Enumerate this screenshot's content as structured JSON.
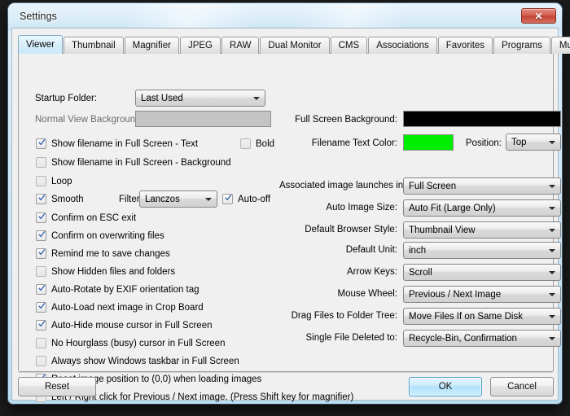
{
  "window": {
    "title": "Settings",
    "close_icon": "close-icon",
    "close_glyph": "✕"
  },
  "tabs": [
    {
      "label": "Viewer",
      "active": true
    },
    {
      "label": "Thumbnail",
      "active": false
    },
    {
      "label": "Magnifier",
      "active": false
    },
    {
      "label": "JPEG",
      "active": false
    },
    {
      "label": "RAW",
      "active": false
    },
    {
      "label": "Dual Monitor",
      "active": false
    },
    {
      "label": "CMS",
      "active": false
    },
    {
      "label": "Associations",
      "active": false
    },
    {
      "label": "Favorites",
      "active": false
    },
    {
      "label": "Programs",
      "active": false
    },
    {
      "label": "Music",
      "active": false
    }
  ],
  "left": {
    "startup_folder_label": "Startup Folder:",
    "startup_folder_value": "Last Used",
    "normal_view_background_label": "Normal View Background:",
    "normal_view_background_color": "#c4c4c4",
    "filter_label": "Filter:",
    "filter_value": "Lanczos",
    "auto_off_label": "Auto-off",
    "bold_label": "Bold",
    "checkboxes": [
      {
        "label": "Show filename in Full Screen - Text",
        "checked": true
      },
      {
        "label": "Show filename in Full Screen - Background",
        "checked": false
      },
      {
        "label": "Loop",
        "checked": false
      },
      {
        "label": "Smooth",
        "checked": true
      },
      {
        "label": "Confirm on ESC exit",
        "checked": true
      },
      {
        "label": "Confirm on overwriting files",
        "checked": true
      },
      {
        "label": "Remind me to save changes",
        "checked": true
      },
      {
        "label": "Show Hidden files and folders",
        "checked": false
      },
      {
        "label": "Auto-Rotate by EXIF orientation tag",
        "checked": true
      },
      {
        "label": "Auto-Load next image in Crop Board",
        "checked": true
      },
      {
        "label": "Auto-Hide mouse cursor in Full Screen",
        "checked": true
      },
      {
        "label": "No Hourglass (busy) cursor in Full Screen",
        "checked": false
      },
      {
        "label": "Always show Windows taskbar in Full Screen",
        "checked": false
      },
      {
        "label": "Reset image position to (0,0) when loading images",
        "checked": true
      },
      {
        "label": "Left / Right click for Previous / Next image. (Press Shift key for magnifier)",
        "checked": false
      }
    ]
  },
  "right": {
    "full_screen_background_label": "Full Screen Background:",
    "full_screen_background_color": "#000000",
    "filename_text_color_label": "Filename Text Color:",
    "filename_text_color": "#00ee00",
    "position_label": "Position:",
    "position_value": "Top",
    "dropdowns": [
      {
        "label": "Associated image launches in:",
        "value": "Full Screen"
      },
      {
        "label": "Auto Image Size:",
        "value": "Auto Fit (Large Only)"
      },
      {
        "label": "Default Browser Style:",
        "value": "Thumbnail View"
      },
      {
        "label": "Default Unit:",
        "value": "inch"
      },
      {
        "label": "Arrow Keys:",
        "value": "Scroll"
      },
      {
        "label": "Mouse Wheel:",
        "value": "Previous / Next Image"
      },
      {
        "label": "Drag Files to Folder Tree:",
        "value": "Move Files If on Same Disk"
      },
      {
        "label": "Single File Deleted to:",
        "value": "Recycle-Bin, Confirmation"
      }
    ]
  },
  "buttons": {
    "reset": "Reset",
    "ok": "OK",
    "cancel": "Cancel"
  }
}
